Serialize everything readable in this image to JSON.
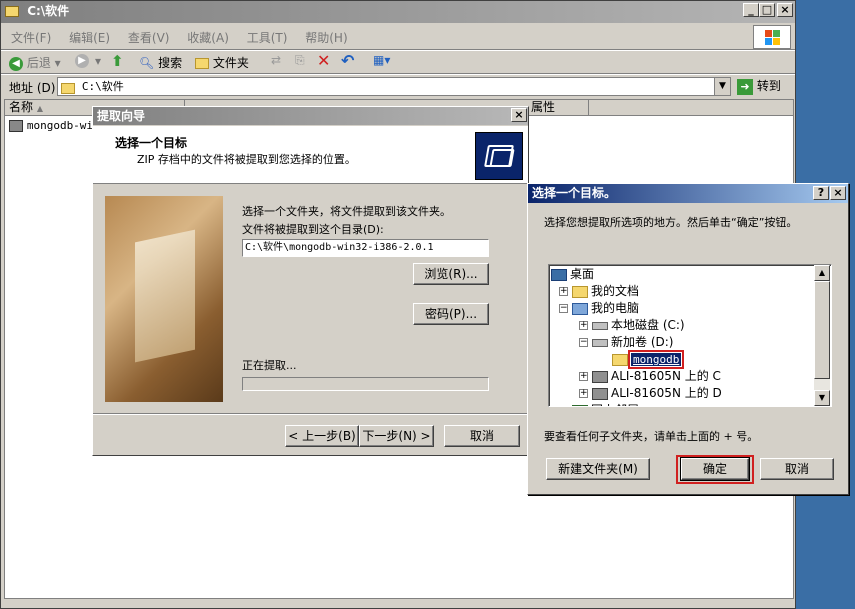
{
  "explorer": {
    "title": "C:\\软件",
    "menu": [
      "文件(F)",
      "编辑(E)",
      "查看(V)",
      "收藏(A)",
      "工具(T)",
      "帮助(H)"
    ],
    "toolbar": {
      "back": "后退",
      "search": "搜索",
      "folders": "文件夹"
    },
    "address_label": "地址 (D)",
    "address_value": "C:\\软件",
    "go_label": "转到",
    "columns": [
      "名称",
      "属性"
    ],
    "files": [
      "mongodb-win"
    ]
  },
  "wizard": {
    "title": "提取向导",
    "heading": "选择一个目标",
    "subheading": "ZIP 存档中的文件将被提取到您选择的位置。",
    "instruction": "选择一个文件夹，将文件提取到该文件夹。",
    "dir_label": "文件将被提取到这个目录(D):",
    "dir_value": "C:\\软件\\mongodb-win32-i386-2.0.1",
    "browse_label": "浏览(R)...",
    "password_label": "密码(P)...",
    "progress_label": "正在提取...",
    "back_label": "< 上一步(B)",
    "next_label": "下一步(N) >",
    "cancel_label": "取消"
  },
  "browse_dialog": {
    "title": "选择一个目标。",
    "help_btn": "?",
    "prompt": "选择您想提取所选项的地方。然后单击“确定”按钮。",
    "tree": [
      {
        "label": "桌面",
        "icon": "desktop-icon",
        "level": 0,
        "toggle": ""
      },
      {
        "label": "我的文档",
        "icon": "my-documents-icon",
        "level": 1,
        "toggle": "+"
      },
      {
        "label": "我的电脑",
        "icon": "my-computer-icon",
        "level": 1,
        "toggle": "-"
      },
      {
        "label": "本地磁盘 (C:)",
        "icon": "drive-icon",
        "level": 2,
        "toggle": "+"
      },
      {
        "label": "新加卷 (D:)",
        "icon": "drive-icon",
        "level": 2,
        "toggle": "-"
      },
      {
        "label": "mongodb",
        "icon": "folder-icon",
        "level": 3,
        "toggle": "",
        "selected": true
      },
      {
        "label": "ALI-81605N 上的 C",
        "icon": "network-drive-icon",
        "level": 2,
        "toggle": "+"
      },
      {
        "label": "ALI-81605N 上的 D",
        "icon": "network-drive-icon",
        "level": 2,
        "toggle": "+"
      },
      {
        "label": "网上邻居",
        "icon": "network-icon",
        "level": 1,
        "toggle": "+"
      }
    ],
    "hint": "要查看任何子文件夹，请单击上面的 + 号。",
    "new_folder_label": "新建文件夹(M)",
    "ok_label": "确定",
    "cancel_label": "取消"
  }
}
